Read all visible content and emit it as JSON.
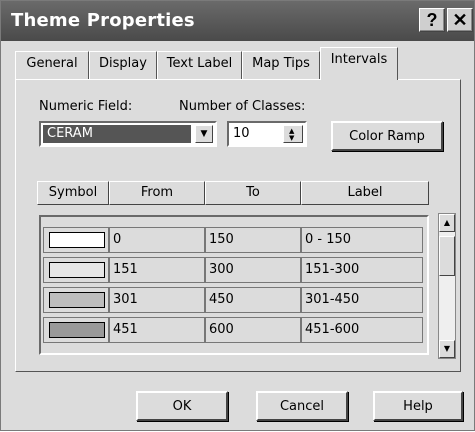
{
  "window": {
    "title": "Theme Properties",
    "help_glyph": "?",
    "close_glyph": "✕"
  },
  "tabs": [
    {
      "label": "General",
      "active": false
    },
    {
      "label": "Display",
      "active": false
    },
    {
      "label": "Text Label",
      "active": false
    },
    {
      "label": "Map Tips",
      "active": false
    },
    {
      "label": "Intervals",
      "active": true
    }
  ],
  "intervals": {
    "numeric_field_label": "Numeric Field:",
    "numeric_field_value": "CERAM",
    "classes_label": "Number of Classes:",
    "classes_value": "10",
    "color_ramp_label": "Color Ramp",
    "columns": [
      "Symbol",
      "From",
      "To",
      "Label"
    ],
    "rows": [
      {
        "color": "#ffffff",
        "from": "0",
        "to": "150",
        "label": "0 - 150"
      },
      {
        "color": "#e6e6e6",
        "from": "151",
        "to": "300",
        "label": "151-300"
      },
      {
        "color": "#bdbdbd",
        "from": "301",
        "to": "450",
        "label": "301-450"
      },
      {
        "color": "#999999",
        "from": "451",
        "to": "600",
        "label": "451-600"
      }
    ]
  },
  "footer": {
    "ok_label": "OK",
    "cancel_label": "Cancel",
    "help_label": "Help"
  }
}
